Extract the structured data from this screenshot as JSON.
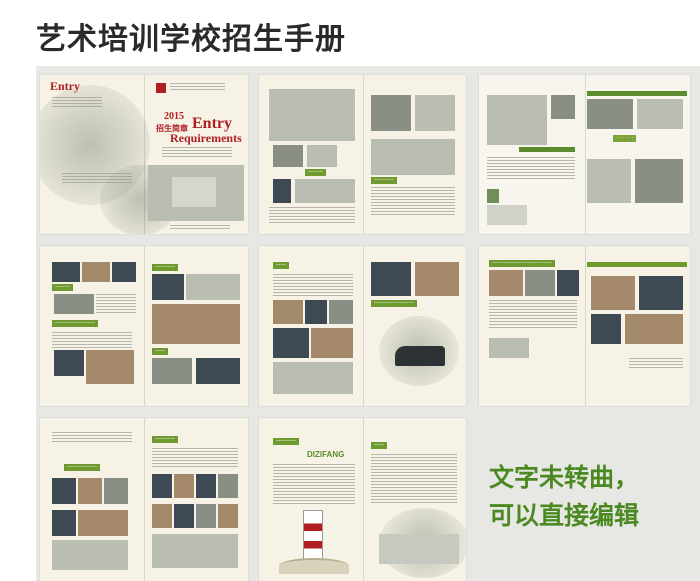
{
  "header": {
    "title": "艺术培训学校招生手册"
  },
  "cover": {
    "year": "2015",
    "label": "招生简章",
    "entry": "Entry",
    "requirements": "Requirements"
  },
  "page_labels": {
    "p8_green": "DIZIFANG"
  },
  "note": {
    "line1": "文字未转曲，",
    "line2": "可以直接编辑"
  },
  "colors": {
    "accent": "#5b8b2c",
    "title": "#2a2a2a",
    "note": "#4b8a22",
    "cover_red": "#b01e22"
  }
}
